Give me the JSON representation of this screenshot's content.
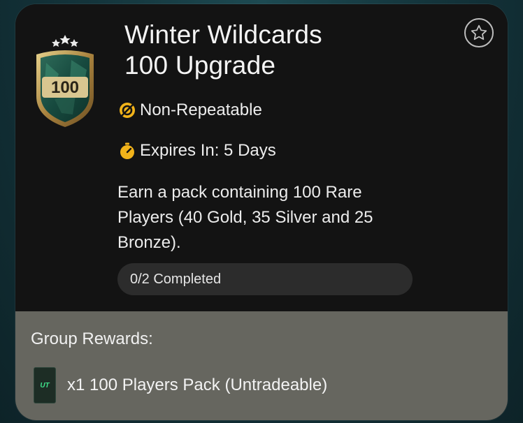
{
  "objective": {
    "badge_value": "100",
    "title_line1": "Winter Wildcards",
    "title_line2": "100 Upgrade",
    "repeatability": "Non-Repeatable",
    "expiry": "Expires In: 5 Days",
    "description": "Earn a pack containing 100 Rare Players (40 Gold, 35 Silver and 25 Bronze).",
    "progress_text": "0/2 Completed",
    "progress_fraction": 0
  },
  "rewards": {
    "heading": "Group Rewards:",
    "items": [
      {
        "icon_label": "UT",
        "text": "x1 100 Players Pack (Untradeable)"
      }
    ]
  },
  "colors": {
    "accent_gold": "#f2b31a",
    "card_bg": "#131313",
    "rewards_bg": "#66665f"
  }
}
